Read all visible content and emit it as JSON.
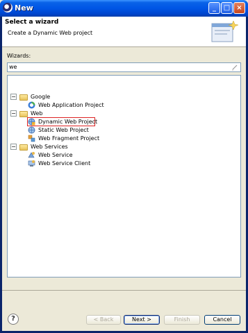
{
  "window": {
    "title": "New"
  },
  "header": {
    "title": "Select a wizard",
    "description": "Create a Dynamic Web project"
  },
  "wizards": {
    "label": "Wizards:",
    "filter_value": "we"
  },
  "tree": {
    "groups": [
      {
        "label": "Google",
        "expander": "−",
        "children": [
          "Web Application Project"
        ]
      },
      {
        "label": "Web",
        "expander": "−",
        "children": [
          "Dynamic Web Project",
          "Static Web Project",
          "Web Fragment Project"
        ]
      },
      {
        "label": "Web Services",
        "expander": "−",
        "children": [
          "Web Service",
          "Web Service Client"
        ]
      }
    ],
    "selected": "Dynamic Web Project"
  },
  "buttons": {
    "help": "?",
    "back": "< Back",
    "next": "Next >",
    "finish": "Finish",
    "cancel": "Cancel"
  },
  "titlebar_buttons": {
    "minimize": "_",
    "maximize": "□",
    "close": "×"
  },
  "colors": {
    "selection_border": "#dd2222",
    "titlebar": "#0055e5"
  }
}
